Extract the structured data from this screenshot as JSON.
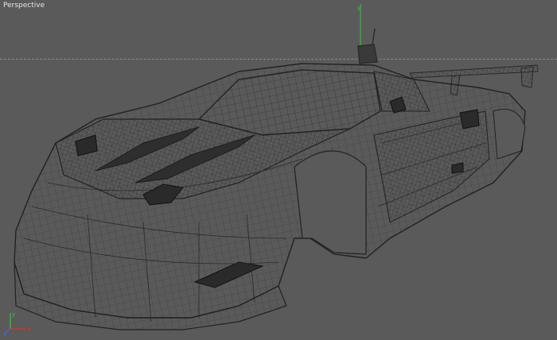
{
  "viewport": {
    "label": "Perspective",
    "background": "#5a5a5a",
    "wire_color": "#2a2a2a",
    "grid_color": "#8c8c8c"
  },
  "gizmo": {
    "x_label": "x",
    "y_label": "y",
    "z_label": "z",
    "x_color": "#e03030",
    "y_color": "#40c040",
    "z_color": "#4060ff"
  },
  "object_axis": {
    "y_label": "y",
    "y_color": "#40c040"
  },
  "model": {
    "icon": "wireframe-race-car"
  }
}
